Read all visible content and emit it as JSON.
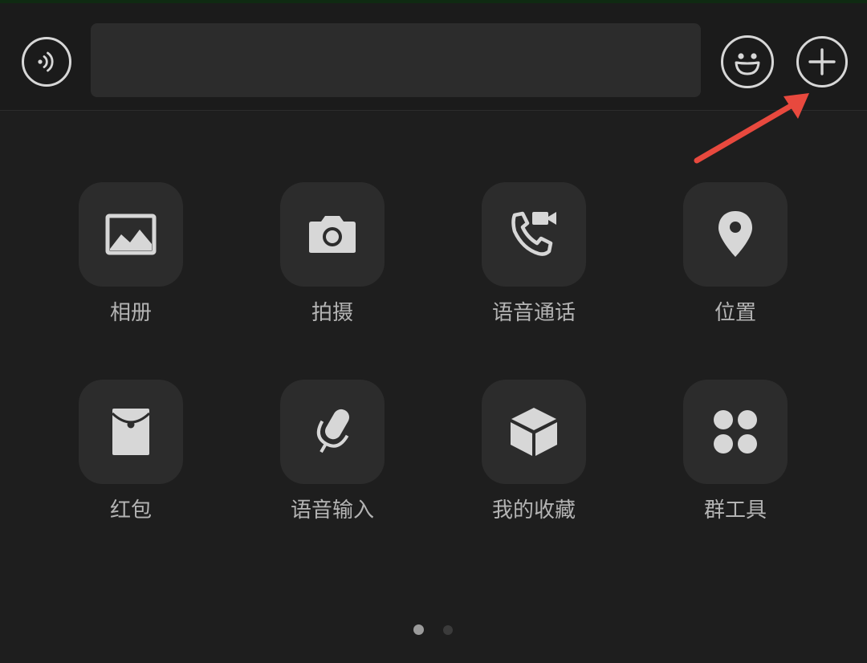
{
  "input_bar": {
    "voice_icon": "voice-wave-icon",
    "text_value": "",
    "emoji_icon": "smiley-face-icon",
    "plus_icon": "plus-circle-icon"
  },
  "annotation": {
    "arrow_color": "#e8493e"
  },
  "panel": {
    "tiles": [
      {
        "label": "相册",
        "icon": "photo-album-icon"
      },
      {
        "label": "拍摄",
        "icon": "camera-icon"
      },
      {
        "label": "语音通话",
        "icon": "voice-video-call-icon"
      },
      {
        "label": "位置",
        "icon": "location-pin-icon"
      },
      {
        "label": "红包",
        "icon": "red-envelope-icon"
      },
      {
        "label": "语音输入",
        "icon": "microphone-icon"
      },
      {
        "label": "我的收藏",
        "icon": "favorites-cube-icon"
      },
      {
        "label": "群工具",
        "icon": "group-tools-icon"
      }
    ],
    "page_indicator": {
      "current_page": 1,
      "total_pages": 2
    }
  },
  "colors": {
    "background": "#1e1e1e",
    "tile_bg": "#2c2c2c",
    "icon": "#d7d7d7",
    "label": "#b4b4b4"
  }
}
